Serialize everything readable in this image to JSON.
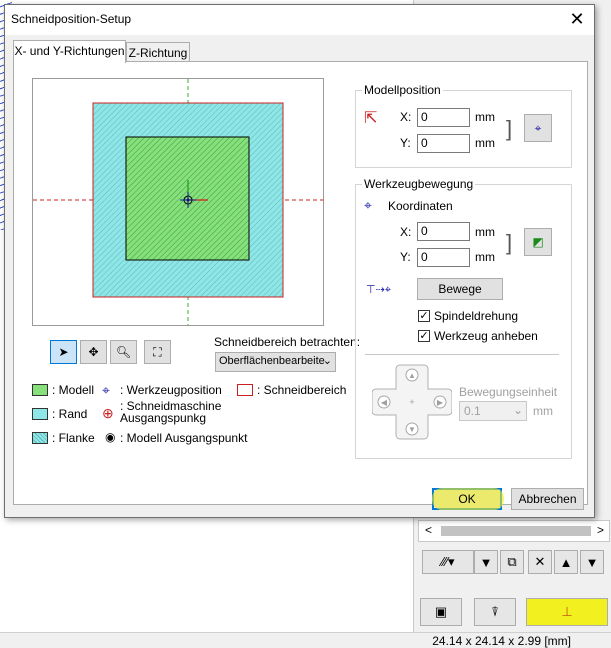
{
  "dialog": {
    "title": "Schneidposition-Setup",
    "close_label": "✕",
    "tabs": [
      {
        "label": "X- und Y-Richtungen"
      },
      {
        "label": "Z-Richtung"
      }
    ]
  },
  "modellposition": {
    "label": "Modellposition",
    "x_label": "X:",
    "x_value": "0",
    "y_label": "Y:",
    "y_value": "0",
    "unit": "mm"
  },
  "werkzeugbewegung": {
    "label": "Werkzeugbewegung",
    "koordinaten_label": "Koordinaten",
    "x_label": "X:",
    "x_value": "0",
    "y_label": "Y:",
    "y_value": "0",
    "unit": "mm",
    "move_button": "Bewege",
    "spindeldrehung_label": "Spindeldrehung",
    "spindeldrehung_checked": true,
    "werkzeug_anheben_label": "Werkzeug anheben",
    "werkzeug_anheben_checked": true,
    "bewegungseinheit_label": "Bewegungseinheit",
    "bewegungseinheit_value": "0.1",
    "bewegungseinheit_unit": "mm"
  },
  "view": {
    "schneidbereich_label": "Schneidbereich betrachten:",
    "schneidbereich_value": "Oberflächenbearbeite"
  },
  "legend": {
    "modell": ": Modell",
    "rand": ": Rand",
    "flanke": ": Flanke",
    "werkzeugposition": ": Werkzeugposition",
    "schneidmaschine": ": Schneidmaschine Ausgangspunkg",
    "modell_ausgangspunkt": ": Modell Ausgangspunkt",
    "schneidbereich": ": Schneidbereich"
  },
  "footer": {
    "ok_label": "OK",
    "cancel_label": "Abbrechen"
  },
  "status_bar": {
    "dimensions": "24.14 x 24.14 x 2.99 [mm]"
  },
  "colors": {
    "model_green": "#86e07c",
    "edge_cyan": "#8fe6e6",
    "cut_area_red": "#d9534f",
    "highlight_yellow": "#f3f020",
    "accent_blue": "#0078d7"
  }
}
